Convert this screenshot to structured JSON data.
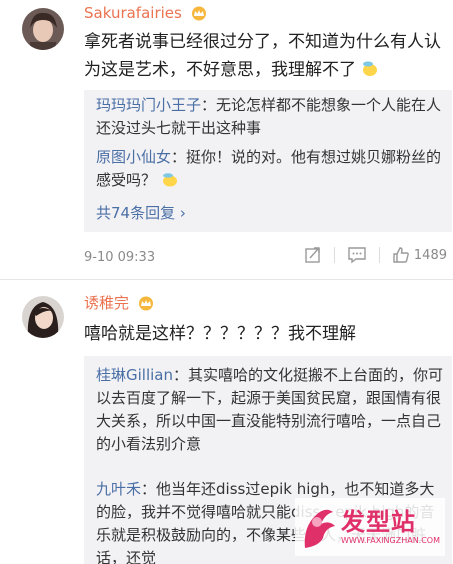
{
  "comments": [
    {
      "username": "Sakurafairies",
      "text": "拿死者说事已经很过分了，不知道为什么有人认为这是艺术，不好意思，我理解不了",
      "replies": [
        {
          "name": "玛玛玛门小王子",
          "text": "：无论怎样都不能想象一个人能在人还没过头七就干出这种事"
        },
        {
          "name": "原图小仙女",
          "text": "：挺你！说的对。他有想过姚贝娜粉丝的感受吗？"
        }
      ],
      "more_replies": "共74条回复 ›",
      "timestamp": "9-10 09:33",
      "like_count": "1489"
    },
    {
      "username": "诱稚完",
      "text": "嘻哈就是这样？？？？？？我不理解",
      "replies": [
        {
          "name": "桂琳Gillian",
          "text": "：其实嘻哈的文化挺搬不上台面的，你可以去百度了解一下，起源于美国贫民窟，跟国情有很大关系，所以中国一直没能特别流行嘻哈，一点自己的小看法别介意"
        },
        {
          "name": "九叶禾",
          "text": "：他当年还diss过epik high，也不知道多大的脸，我并不觉得嘻哈就只能diss，epik high的音乐就是积极鼓励向的，不像某些个人，天天满口脏话，还觉"
        }
      ]
    }
  ],
  "watermark": {
    "brand": "发型站",
    "url": "WWW.FAXINGZHAN.COM"
  },
  "icons": [
    "crown-badge-icon",
    "share-icon",
    "comment-icon",
    "like-icon",
    "emoji-icon"
  ],
  "colors": {
    "username": "#eb7350",
    "reply_name": "#4a6fa5",
    "reply_bg": "#f2f2f5",
    "meta": "#8a8a8a"
  }
}
